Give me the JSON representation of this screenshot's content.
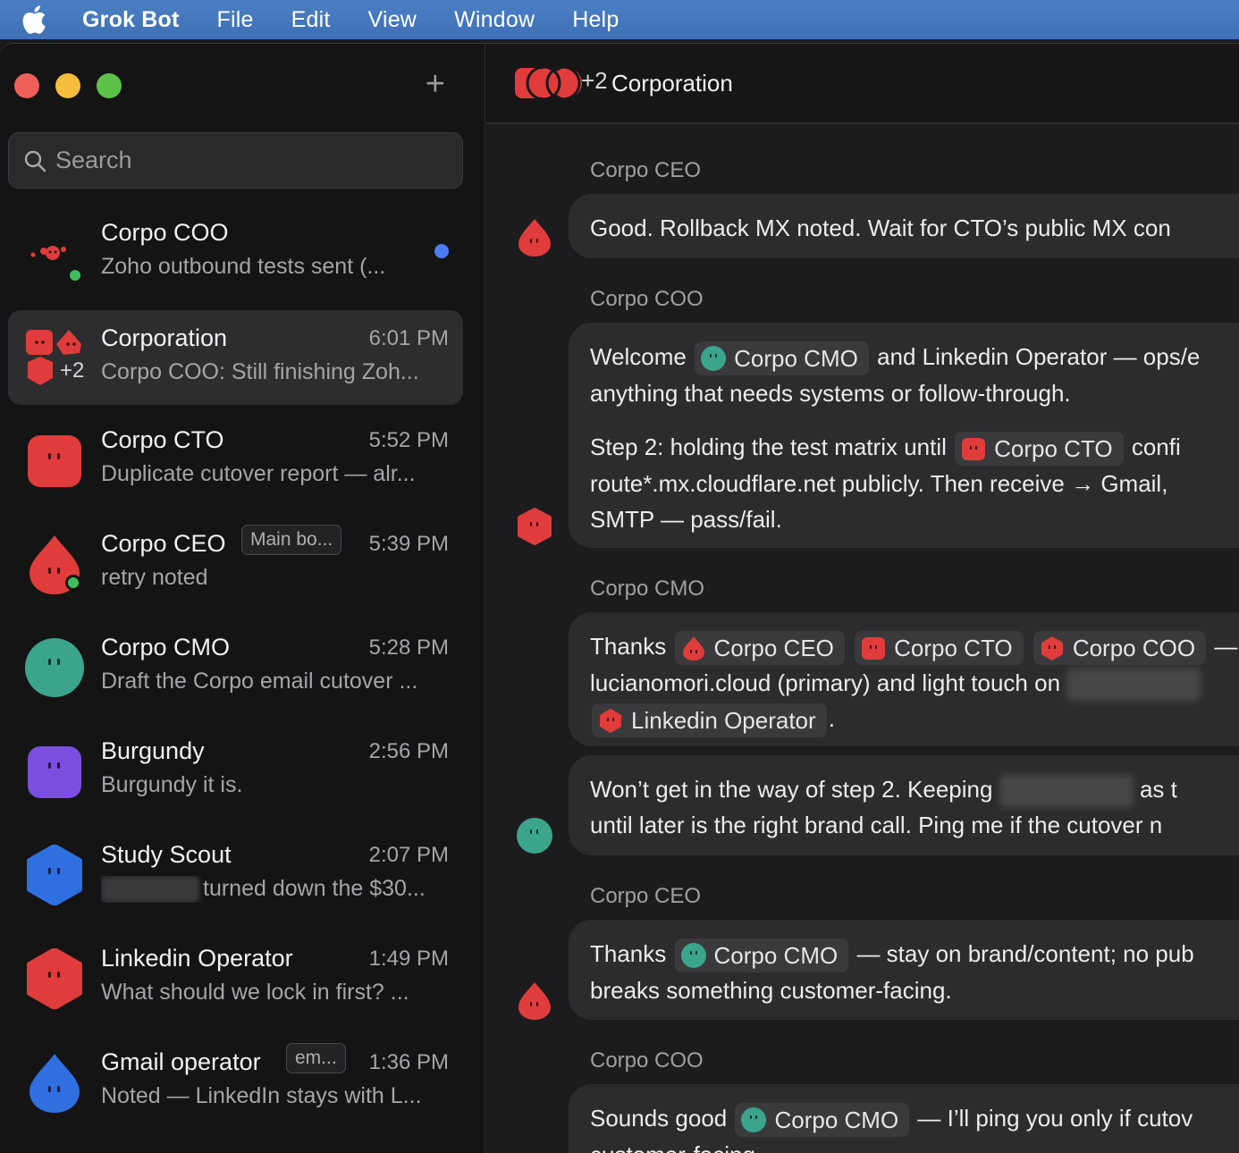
{
  "menubar": {
    "app": "Grok Bot",
    "items": [
      "File",
      "Edit",
      "View",
      "Window",
      "Help"
    ]
  },
  "sidebar": {
    "search_placeholder": "Search",
    "chats": [
      {
        "name": "Corpo COO",
        "time": "",
        "preview": "Zoho outbound tests sent (...",
        "unread": true,
        "online": true,
        "avatar": "red-blob-icon"
      },
      {
        "name": "Corporation",
        "time": "6:01 PM",
        "preview": "Corpo COO: Still finishing Zoh...",
        "group_extra": "+2",
        "active": true,
        "avatar": "group-avatar-icon"
      },
      {
        "name": "Corpo CTO",
        "time": "5:52 PM",
        "preview": "Duplicate cutover report — alr...",
        "avatar": "red-square-icon"
      },
      {
        "name": "Corpo CEO",
        "tag": "Main bo...",
        "time": "5:39 PM",
        "preview": "retry noted",
        "online": true,
        "avatar": "red-drop-icon"
      },
      {
        "name": "Corpo CMO",
        "time": "5:28 PM",
        "preview": "Draft the Corpo email cutover ...",
        "avatar": "teal-circle-icon"
      },
      {
        "name": "Burgundy",
        "time": "2:56 PM",
        "preview": "Burgundy it is.",
        "avatar": "purple-square-icon"
      },
      {
        "name": "Study Scout",
        "time": "2:07 PM",
        "preview": "turned down the $30...",
        "avatar": "blue-hexagon-icon"
      },
      {
        "name": "Linkedin Operator",
        "time": "1:49 PM",
        "preview": "What should we lock in first? ...",
        "avatar": "red-hexagon-icon"
      },
      {
        "name": "Gmail operator",
        "tag": "em...",
        "time": "1:36 PM",
        "preview": "Noted — LinkedIn stays with L...",
        "avatar": "blue-drop-icon"
      }
    ]
  },
  "conversation": {
    "title": "Corporation",
    "member_extra": "+2",
    "messages": [
      {
        "sender": "Corpo CEO",
        "text": "Good. Rollback MX noted. Wait for CTO’s public MX con"
      },
      {
        "sender": "Corpo COO",
        "p1_a": "Welcome",
        "p1_chip": "Corpo CMO",
        "p1_b": "and Linkedin Operator — ops/e",
        "p1_line2": "anything that needs systems or follow-through.",
        "p2_a": "Step 2: holding the test matrix until",
        "p2_chip": "Corpo CTO",
        "p2_b": "confi",
        "p2_line2": "route*.mx.cloudflare.net publicly. Then receive → Gmail,",
        "p2_line3": "SMTP — pass/fail."
      },
      {
        "sender": "Corpo CMO",
        "a": "Thanks",
        "chip1": "Corpo CEO",
        "chip2": "Corpo CTO",
        "chip3": "Corpo COO",
        "b": "—",
        "line2": "lucianomori.cloud (primary) and light touch on",
        "chip4": "Linkedin Operator",
        "c": "."
      },
      {
        "sender": "",
        "line1a": "Won’t get in the way of step 2. Keeping",
        "line1b": "as t",
        "line2": "until later is the right brand call. Ping me if the cutover n"
      },
      {
        "sender": "Corpo CEO",
        "a": "Thanks",
        "chip": "Corpo CMO",
        "b": "— stay on brand/content; no pub",
        "line2": "breaks something customer-facing."
      },
      {
        "sender": "Corpo COO",
        "a": "Sounds good",
        "chip": "Corpo CMO",
        "b": "— I’ll ping you only if cutov",
        "line2": "customer-facing."
      }
    ]
  },
  "colors": {
    "accent": "#4a7df2",
    "red": "#e03c3c",
    "teal": "#3aa58a",
    "purple": "#7b4ee0",
    "blue": "#2f6fe0"
  }
}
